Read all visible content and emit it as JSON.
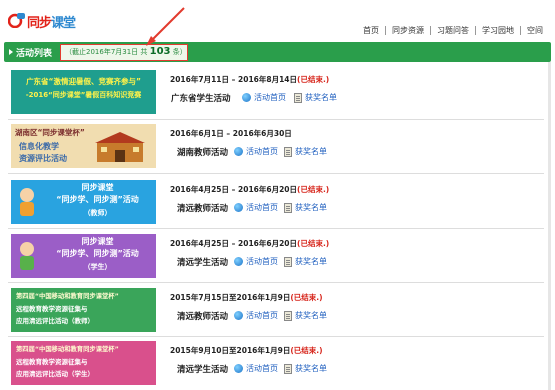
{
  "header": {
    "logo_text_main": "同步",
    "logo_text_light": "课堂",
    "nav": [
      "首页",
      "同步资源",
      "习题问答",
      "学习园地",
      "空间"
    ]
  },
  "activity_bar": {
    "title": "活动列表",
    "stats_prefix": "（截止2016年7月31日 共",
    "stats_count": "103",
    "stats_suffix": "条）"
  },
  "activities": [
    {
      "banner_lines": [
        "广东省“激情迎暑假、竞赛齐参与”",
        "-2016“同步课堂”暑假百科知识竞赛"
      ],
      "date": "2016年7月11日 – 2016年8月14日",
      "status": "(已结束.)",
      "org": "广东省学生活动",
      "home_link": "活动首页",
      "award_link": "获奖名单"
    },
    {
      "banner_lines": [
        "湖南区“同步课堂杯”",
        "信息化教学",
        "资源评比活动"
      ],
      "date": "2016年6月1日 – 2016年6月30日",
      "status": "(已结束.)",
      "org": "湖南教师活动",
      "home_link": "活动首页",
      "award_link": "获奖名单"
    },
    {
      "banner_lines": [
        "同步课堂",
        "“同步学、同步测”活动",
        "（教师）"
      ],
      "date": "2016年4月25日 – 2016年6月20日",
      "status": "(已结束.)",
      "org": "清远教师活动",
      "home_link": "活动首页",
      "award_link": "获奖名单"
    },
    {
      "banner_lines": [
        "同步课堂",
        "“同步学、同步测”活动",
        "（学生）"
      ],
      "date": "2016年4月25日 – 2016年6月20日",
      "status": "(已结束.)",
      "org": "清远学生活动",
      "home_link": "活动首页",
      "award_link": "获奖名单"
    },
    {
      "banner_lines": [
        "第四届“中国移动和教育同步课堂杯”",
        "远程教育教学资源征集与",
        "应用清远评比活动（教师）"
      ],
      "date": "2015年7月15日至2016年1月9日",
      "status": "(已结束.)",
      "org": "清远教师活动",
      "home_link": "活动首页",
      "award_link": "获奖名单"
    },
    {
      "banner_lines": [
        "第四届“中国移动和教育同步课堂杯”",
        "远程教育教学资源征集与",
        "应用清远评比活动（学生）"
      ],
      "date": "2015年9月10日至2016年1月9日",
      "status": "(已结束.)",
      "org": "清远学生活动",
      "home_link": "活动首页",
      "award_link": "获奖名单"
    }
  ],
  "colors": {
    "green_bar": "#2a9e4b",
    "annotation_red": "#e23b2e",
    "ended_red": "#d7261c",
    "link_blue": "#1f5fbf"
  }
}
